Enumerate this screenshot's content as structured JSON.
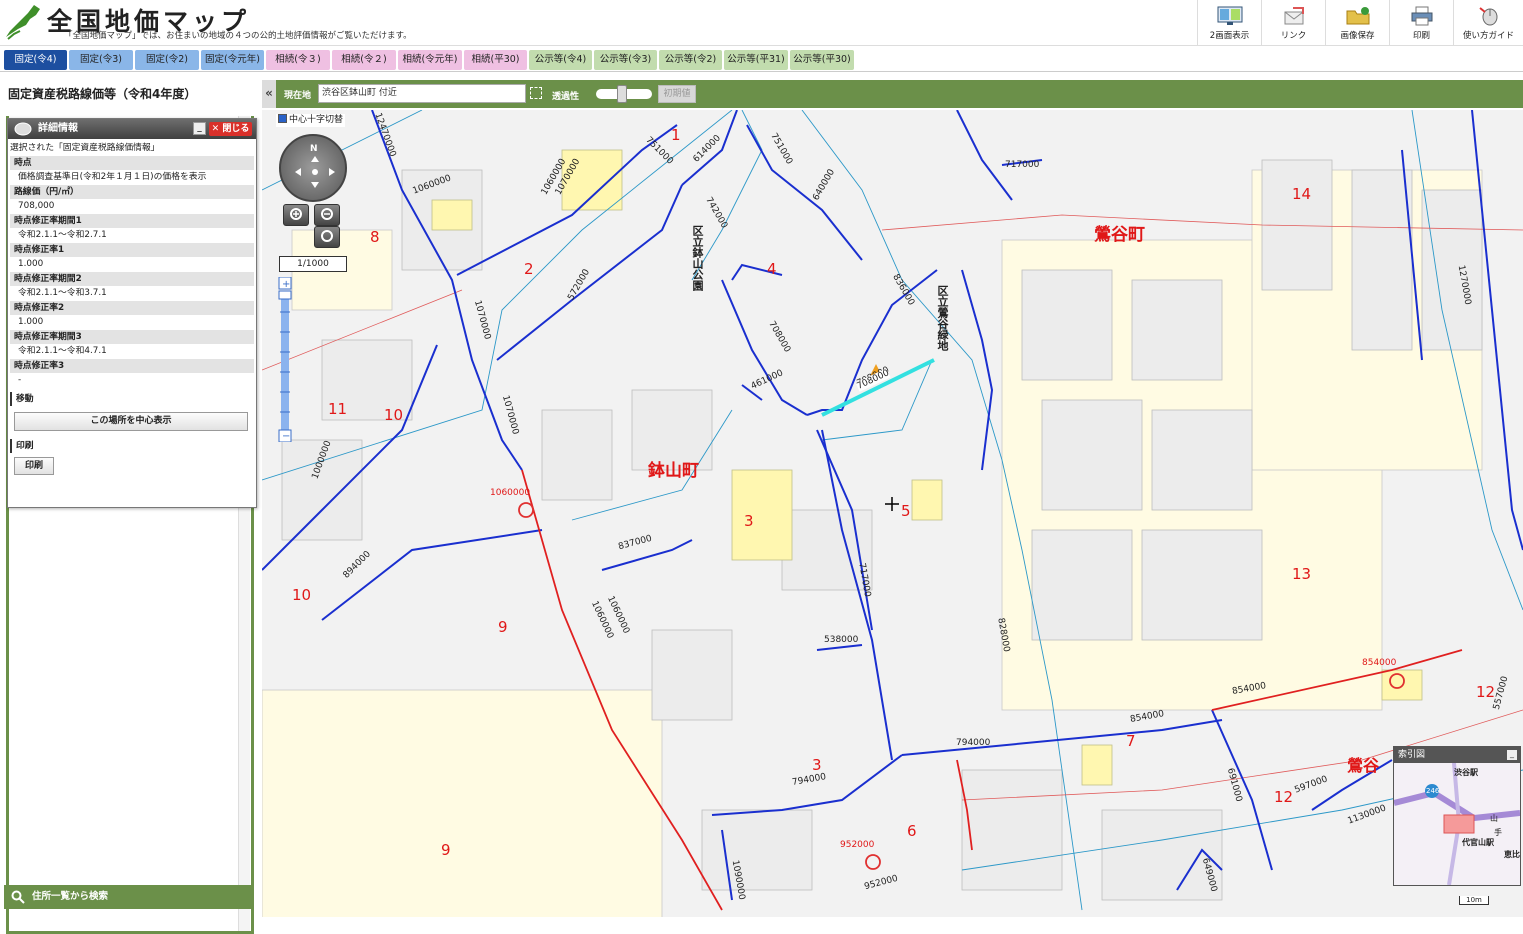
{
  "header": {
    "title": "全国地価マップ",
    "subtitle": "「全国地価マップ」では、お住まいの地域の４つの公的土地評価情報がご覧いただけます。",
    "tools": [
      {
        "label": "2画面表示",
        "icon": "dual-screen-icon"
      },
      {
        "label": "リンク",
        "icon": "link-icon"
      },
      {
        "label": "画像保存",
        "icon": "folder-save-icon"
      },
      {
        "label": "印刷",
        "icon": "printer-icon"
      },
      {
        "label": "使い方ガイド",
        "icon": "mouse-guide-icon"
      }
    ]
  },
  "tabs": [
    {
      "label": "固定(令4)",
      "kind": "active"
    },
    {
      "label": "固定(令3)",
      "kind": "kotei"
    },
    {
      "label": "固定(令2)",
      "kind": "kotei"
    },
    {
      "label": "固定(令元年)",
      "kind": "kotei"
    },
    {
      "label": "相続(令３)",
      "kind": "souzoku"
    },
    {
      "label": "相続(令２)",
      "kind": "souzoku"
    },
    {
      "label": "相続(令元年)",
      "kind": "souzoku"
    },
    {
      "label": "相続(平30)",
      "kind": "souzoku"
    },
    {
      "label": "公示等(令4)",
      "kind": "koji"
    },
    {
      "label": "公示等(令3)",
      "kind": "koji"
    },
    {
      "label": "公示等(令2)",
      "kind": "koji"
    },
    {
      "label": "公示等(平31)",
      "kind": "koji"
    },
    {
      "label": "公示等(平30)",
      "kind": "koji"
    }
  ],
  "left_panel": {
    "title": "固定資産税路線価等（令和4年度）",
    "search_label": "住所一覧から検索"
  },
  "detail": {
    "title": "詳細情報",
    "close_label": "✕ 閉じる",
    "minimize_label": "_",
    "intro": "選択された「固定資産税路線価情報」",
    "rows": [
      {
        "h": "時点",
        "v": "価格調査基準日(令和2年１月１日)の価格を表示"
      },
      {
        "h": "路線価（円/㎡）",
        "v": "708,000"
      },
      {
        "h": "時点修正率期間1",
        "v": "令和2.1.1～令和2.7.1"
      },
      {
        "h": "時点修正率1",
        "v": "1.000"
      },
      {
        "h": "時点修正率期間2",
        "v": "令和2.1.1～令和3.7.1"
      },
      {
        "h": "時点修正率2",
        "v": "1.000"
      },
      {
        "h": "時点修正率期間3",
        "v": "令和2.1.1～令和4.7.1"
      },
      {
        "h": "時点修正率3",
        "v": "-"
      }
    ],
    "move_section": "移動",
    "center_button": "この場所を中心表示",
    "print_section": "印刷",
    "print_button": "印刷"
  },
  "map_toolbar": {
    "collapse_icon": "«",
    "location_label": "現在地",
    "location_value": "渋谷区鉢山町 付近",
    "opacity_label": "透過性",
    "opacity_level": 0.45,
    "reset_label": "初期値"
  },
  "map": {
    "cross_toggle": "中心十字切替",
    "compass_n": "N",
    "scale": "1/1000",
    "town_names": [
      "鉢山町",
      "鶯谷町",
      "鶯谷"
    ],
    "park_names": [
      "区立鉢山公園",
      "区立鶯谷緑地"
    ],
    "block_numbers": [
      "1",
      "2",
      "3",
      "3",
      "4",
      "5",
      "6",
      "7",
      "8",
      "9",
      "9",
      "10",
      "10",
      "11",
      "12",
      "12",
      "13",
      "14"
    ],
    "road_prices": [
      "751000",
      "614000",
      "751000",
      "717000",
      "1060000",
      "1060000",
      "1070000",
      "640000",
      "742000",
      "572000",
      "836000",
      "1070000",
      "708000",
      "461000",
      "708000",
      "1070000",
      "1000000",
      "894000",
      "837000",
      "1060000",
      "717000",
      "538000",
      "828000",
      "854000",
      "854000",
      "794000",
      "794000",
      "1060000",
      "952000",
      "952000",
      "1090000",
      "691000",
      "597000",
      "649000",
      "1130000",
      "557000",
      "1270000",
      "854000",
      "12470000"
    ],
    "highlight_price": "708000",
    "overview_title": "索引図",
    "overview_labels": [
      "渋谷駅",
      "代官山駅",
      "恵比",
      "山",
      "手",
      "246"
    ],
    "scalebar": "10m",
    "marked_point_price": "1060000"
  }
}
